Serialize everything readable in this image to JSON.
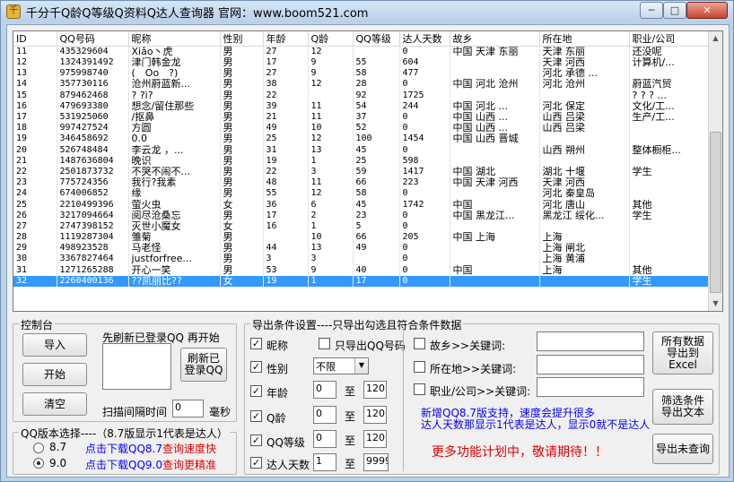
{
  "window": {
    "title": "千分千Q龄Q等级Q资料Q达人查询器 官网：www.boom521.com",
    "min": "─",
    "max": "□",
    "close": "✕"
  },
  "grid": {
    "columns": [
      "ID",
      "QQ号码",
      "昵称",
      "性别",
      "年龄",
      "Q龄",
      "QQ等级",
      "达人天数",
      "故乡",
      "所在地",
      "职业/公司"
    ],
    "rows": [
      [
        "11",
        "435329604",
        "Xiǎo丶虎",
        "男",
        "27",
        "12",
        "",
        "0",
        "中国 天津 东丽",
        "天津 东丽",
        "还没呢"
      ],
      [
        "12",
        "1324391492",
        "津门韩金龙",
        "男",
        "17",
        "9",
        "55",
        "604",
        "",
        "天津 河西",
        "计算机/..."
      ],
      [
        "13",
        "975998740",
        "(￣Oo￣?)",
        "男",
        "27",
        "9",
        "58",
        "477",
        "",
        "河北 承德 ...",
        ""
      ],
      [
        "14",
        "357730116",
        "沧州蔚蓝新...",
        "男",
        "38",
        "12",
        "28",
        "0",
        "中国 河北 沧州",
        "河北 沧州",
        "蔚蓝汽贸"
      ],
      [
        "15",
        "879462468",
        "?    ?ì?",
        "男",
        "22",
        "",
        "92",
        "1725",
        "",
        "",
        "? ? ? ..."
      ],
      [
        "16",
        "479693380",
        "想念/留住那些",
        "男",
        "39",
        "11",
        "54",
        "244",
        "中国 河北 ...",
        "河北 保定",
        "文化/工..."
      ],
      [
        "17",
        "531925060",
        "/抠鼻",
        "男",
        "21",
        "11",
        "37",
        "0",
        "中国 山西 ...",
        "山西 吕梁",
        "生产/工..."
      ],
      [
        "18",
        "997427524",
        "方圆",
        "男",
        "49",
        "10",
        "52",
        "0",
        "中国 山西 ...",
        "山西 吕梁",
        ""
      ],
      [
        "19",
        "346458692",
        "0.0",
        "男",
        "25",
        "12",
        "100",
        "1454",
        "中国 山西 晋城",
        "",
        ""
      ],
      [
        "20",
        "526748484",
        "李云龙  ，...",
        "男",
        "31",
        "13",
        "45",
        "0",
        "",
        "山西 朔州",
        "整体橱柜..."
      ],
      [
        "21",
        "1487636804",
        "晚识",
        "男",
        "19",
        "1",
        "25",
        "598",
        "",
        "",
        ""
      ],
      [
        "22",
        "2501873732",
        "不哭不闹不...",
        "男",
        "22",
        "3",
        "59",
        "1417",
        "中国 湖北",
        "湖北 十堰",
        "学生"
      ],
      [
        "23",
        "775724356",
        "我行?我素",
        "男",
        "48",
        "11",
        "66",
        "223",
        "中国 天津 河西",
        "天津 河西",
        ""
      ],
      [
        "24",
        "674006852",
        "缘",
        "男",
        "55",
        "12",
        "58",
        "0",
        "",
        "河北 秦皇岛",
        ""
      ],
      [
        "25",
        "2210499396",
        "萤火虫",
        "女",
        "36",
        "6",
        "45",
        "1742",
        "中国",
        "河北 唐山",
        "其他"
      ],
      [
        "26",
        "3217094664",
        "阅尽沧桑忘",
        "男",
        "17",
        "2",
        "23",
        "0",
        "中国 黑龙江...",
        "黑龙江 绥化...",
        "学生"
      ],
      [
        "27",
        "2747398152",
        "灭世小魔女",
        "女",
        "16",
        "1",
        "5",
        "0",
        "",
        "",
        ""
      ],
      [
        "28",
        "1119287304",
        "雏菊",
        "男",
        "",
        "10",
        "66",
        "205",
        "中国 上海",
        "上海",
        ""
      ],
      [
        "29",
        "498923528",
        "马老怪",
        "男",
        "44",
        "13",
        "49",
        "0",
        "",
        "上海 闸北",
        ""
      ],
      [
        "30",
        "3367827464",
        "justforfree...",
        "男",
        "3",
        "3",
        "",
        "0",
        "",
        "上海 黄浦",
        ""
      ],
      [
        "31",
        "1271265288",
        "开心一笑",
        "男",
        "53",
        "9",
        "40",
        "0",
        "中国",
        "上海",
        "其他"
      ],
      [
        "32",
        "2260400136",
        "??凯丽比??",
        "女",
        "19",
        "1",
        "17",
        "0",
        "",
        "",
        "学生"
      ]
    ]
  },
  "control": {
    "title": "控制台",
    "import_btn": "导入",
    "start_btn": "开始",
    "clear_btn": "清空",
    "hint": "先刷新已登录QQ 再开始",
    "refresh_btn_l1": "刷新已",
    "refresh_btn_l2": "登录QQ",
    "interval_label": "扫描间隔时间",
    "interval_value": "0",
    "interval_unit": "毫秒"
  },
  "version": {
    "title": "QQ版本选择----（8.7版显示1代表是达人）",
    "options": [
      {
        "label": "8.7",
        "link": "点击下载QQ8.7",
        "note": "查询速度快",
        "selected": false
      },
      {
        "label": "9.0",
        "link": "点击下载QQ9.0",
        "note": "查询更精准",
        "selected": true
      }
    ]
  },
  "export": {
    "title": "导出条件设置----只导出勾选且符合条件数据",
    "nickname": "昵称",
    "only_qq": "只导出QQ号码",
    "gender": "性别",
    "gender_value": "不限",
    "age": "年龄",
    "age_from": "0",
    "age_to": "120",
    "qage": "Q龄",
    "qage_from": "0",
    "qage_to": "120",
    "level": "QQ等级",
    "level_from": "0",
    "level_to": "120",
    "days": "达人天数",
    "days_from": "1",
    "days_to": "9999",
    "to": "至",
    "hometown": "故乡>>关键词:",
    "location": "所在地>>关键词:",
    "job": "职业/公司>>关键词:",
    "note1": "新增QQ8.7版支持，速度会提升很多",
    "note2": "达人天数那显示1代表是达人，显示0就不是达人",
    "more": "更多功能计划中，敬请期待！！",
    "btn_export_all_l1": "所有数据",
    "btn_export_all_l2": "导出到",
    "btn_export_all_l3": "Excel",
    "btn_filter_l1": "筛选条件",
    "btn_filter_l2": "导出文本",
    "btn_unqueried": "导出未查询"
  }
}
